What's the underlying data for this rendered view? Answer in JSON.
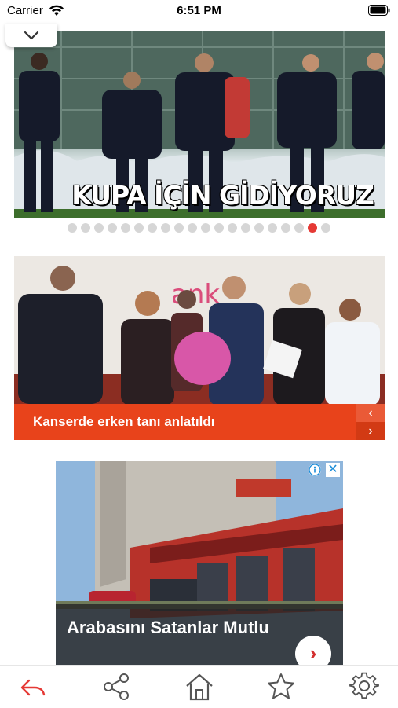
{
  "status_bar": {
    "carrier": "Carrier",
    "time": "6:51 PM"
  },
  "hero": {
    "caption": "KUPA İÇİN GİDİYORUZ",
    "dot_count": 20,
    "active_dot": 18
  },
  "news_card": {
    "caption": "Kanserde erken tanı anlatıldı",
    "prev_icon": "‹",
    "next_icon": "›"
  },
  "ad": {
    "title": "Arabasını Satanlar Mutlu",
    "close_icon": "✕",
    "go_icon": "›"
  },
  "toolbar": {
    "icons": [
      "back-icon",
      "share-icon",
      "home-icon",
      "star-icon",
      "settings-icon"
    ]
  },
  "colors": {
    "accent": "#e8431b",
    "active_dot": "#e53935",
    "back_icon": "#e53935",
    "toolbar_icon": "#555555"
  }
}
